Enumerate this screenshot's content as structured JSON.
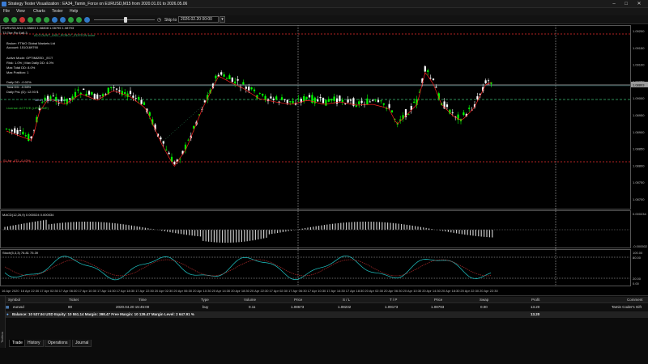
{
  "window": {
    "title": "Strategy Tester Visualization : EA34_Tamin_Force on EURUSD,M15 from 2020.01.01 to 2026.05.06",
    "minimize": "–",
    "maximize": "□",
    "close": "✕"
  },
  "menu": [
    "File",
    "View",
    "Charts",
    "Tester",
    "Help"
  ],
  "toolbar": {
    "skip_to_label": "Skip to",
    "skip_to_value": "2026.02.20 00:00",
    "dropdown_arrow": "▾"
  },
  "chart": {
    "symbol_header": "EURUSD,M15  1.08803  1.08808  1.08795  1.08793",
    "ea_label": "T3 The Fix Ea9.3",
    "header_link": "ACCOUNT_AND_ROBOT_EDITION store",
    "panel_lines": [
      "Broker: FTMO Global Markets Ltd",
      "Account: 1510169790",
      "Active Mode: OPTIMIZED _ECT",
      "Risk: 1.0% | Max Daily DD: 4.0%",
      "Max Total DD: 8.0%",
      "Max Position: 1",
      "Daily DD: -0.02%",
      "Total DD: -0.56%",
      "Daily PnL (D): 12.93 $"
    ],
    "channel_label": "Tamin_Code_Channel",
    "license_label": "License: ACTIVE (LIFETIME)",
    "sl_label": "SL for -4TL -0.43%",
    "price_labels": [
      "1.09200",
      "1.09150",
      "1.09100",
      "1.09050",
      "1.09000",
      "1.08950",
      "1.08900",
      "1.08850",
      "1.08800",
      "1.08750",
      "1.08700"
    ],
    "current_price": "1.08803",
    "macd_label": "MACD(12,26,9) 0.000024 0.000034",
    "macd_scale_top": "0.000234",
    "macd_scale_bottom": "-0.000502",
    "stoch_label": "Stoch(5,3,3) 76.81 75.39",
    "stoch_scale": [
      "100.00",
      "80.00",
      "20.00",
      "0.00"
    ],
    "time_labels": [
      "16 Apr 2020",
      "16 Apr 22:30",
      "17 Apr 02:30",
      "17 Apr 06:30",
      "17 Apr 10:30",
      "17 Apr 14:30",
      "17 Apr 18:30",
      "17 Apr 22:30",
      "20 Apr 02:30",
      "20 Apr 06:30",
      "20 Apr 10:30",
      "20 Apr 14:30",
      "20 Apr 18:30",
      "20 Apr 22:30",
      "17 Apr 02:30",
      "17 Apr 06:30",
      "17 Apr 10:30",
      "17 Apr 14:30",
      "17 Apr 18:30",
      "20 Apr 02:30",
      "20 Apr 06:30",
      "20 Apr 10:30",
      "20 Apr 14:30",
      "20 Apr 18:30",
      "20 Apr 22:30",
      "20 Apr 22:30"
    ]
  },
  "terminal": {
    "side_label": "Toolbox",
    "columns": [
      "Symbol",
      "Ticket",
      "Time",
      "Type",
      "Volume",
      "Price",
      "S / L",
      "T / P",
      "Price",
      "Swap",
      "Profit",
      "Comment"
    ],
    "row": {
      "symbol": "eurusd",
      "ticket": "80",
      "time": "2020.04.20 15:45:00",
      "type": "buy",
      "volume": "0.11",
      "price": "1.08673",
      "sl": "1.08232",
      "tp": "1.09173",
      "current": "1.08793",
      "swap": "0.00",
      "profit": "13.20",
      "comment": "Tamin Coder's Gift"
    },
    "balance_line": "Balance: 10 537.94 USD  Equity: 10 551.14  Margin: 398.47  Free Margin: 10 139.47  Margin Level: 2 647.91 %",
    "balance_profit": "13.20",
    "tabs": [
      "Trade",
      "History",
      "Operations",
      "Journal"
    ]
  },
  "colors": {
    "bull_candle": "#ffffff",
    "bear_candle": "#00ff00",
    "ma_line": "#ff2020",
    "grid_line": "#3a3a3a",
    "sl_line": "#b22222",
    "tp_line": "#2e8b57",
    "macd_hist": "#c8c8c8",
    "stoch_main": "#20c8c8",
    "stoch_signal": "#c83232"
  }
}
